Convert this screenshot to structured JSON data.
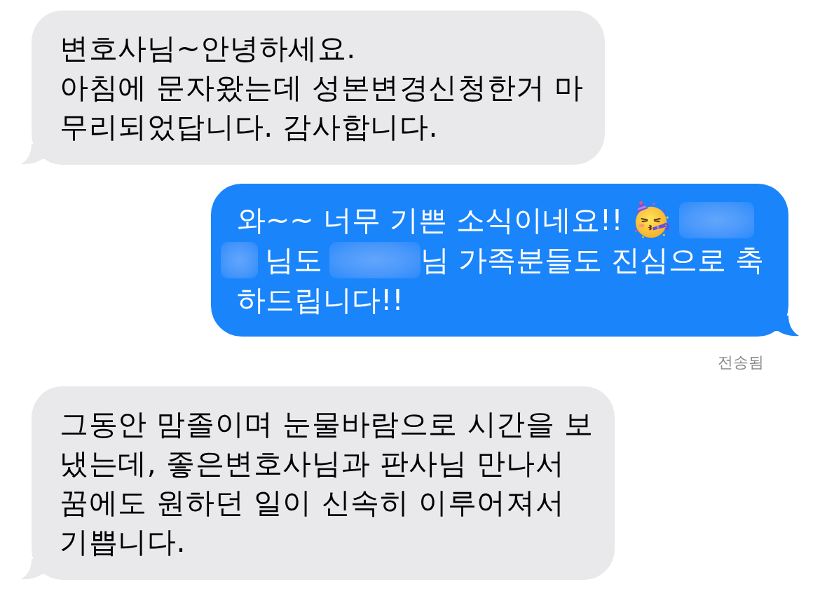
{
  "messages": [
    {
      "kind": "received",
      "text": "변호사님~안녕하세요.\n아침에 문자왔는데 성본변경신청한거 마\n무리되었답니다. 감사합니다."
    },
    {
      "kind": "sent",
      "lines": [
        [
          {
            "kind": "text",
            "text": "와~~ 너무 기쁜 소식이네요!!"
          },
          {
            "kind": "emoji"
          },
          {
            "kind": "redacted"
          }
        ],
        [
          {
            "kind": "redacted"
          },
          {
            "kind": "text",
            "text": "님도"
          },
          {
            "kind": "redacted"
          },
          {
            "kind": "text",
            "text": "님 가족분들도 진심으로 축"
          }
        ],
        [
          {
            "kind": "text",
            "text": "하드립니다!!"
          }
        ]
      ],
      "status": "전송됨"
    },
    {
      "kind": "received",
      "text": "그동안 맘졸이며 눈물바람으로 시간을 보\n냈는데, 좋은변호사님과 판사님 만나서\n꿈에도 원하던 일이 신속히 이루어져서\n기쁩니다."
    }
  ]
}
